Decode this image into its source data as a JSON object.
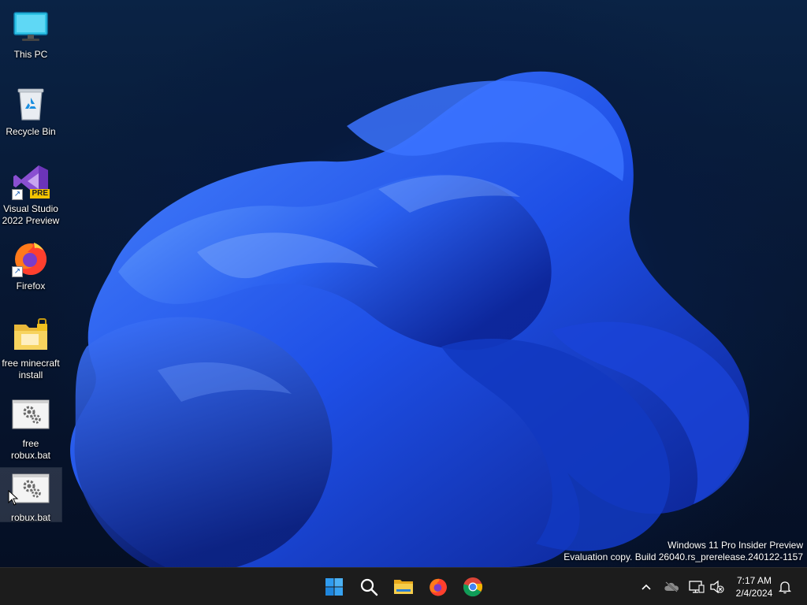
{
  "desktop": {
    "icons": [
      {
        "label": "This PC",
        "icon": "monitor-icon"
      },
      {
        "label": "Recycle Bin",
        "icon": "recycle-bin-icon"
      },
      {
        "label": "Visual Studio 2022 Preview",
        "icon": "visual-studio-icon",
        "badge": "PRE"
      },
      {
        "label": "Firefox",
        "icon": "firefox-icon"
      },
      {
        "label": "free minecraft install",
        "icon": "folder-icon"
      },
      {
        "label": "free robux.bat",
        "icon": "batch-file-icon"
      },
      {
        "label": "robux.bat",
        "icon": "batch-file-icon",
        "selected": true
      }
    ],
    "watermark": {
      "line1": "Windows 11 Pro Insider Preview",
      "line2": "Evaluation copy. Build 26040.rs_prerelease.240122-1157"
    }
  },
  "taskbar": {
    "apps": [
      "start-icon",
      "search-icon",
      "file-explorer-icon",
      "firefox-icon",
      "chrome-icon"
    ],
    "tray": [
      "chevron-up-icon",
      "onedrive-icon",
      "network-icon",
      "volume-muted-icon",
      "notification-bell-icon"
    ],
    "clock": {
      "time": "7:17 AM",
      "date": "2/4/2024"
    }
  },
  "colors": {
    "taskbar_bg": "#1c1c1c",
    "wallpaper_blue": "#1a4fe0",
    "start_blue": "#2f9cf0"
  }
}
